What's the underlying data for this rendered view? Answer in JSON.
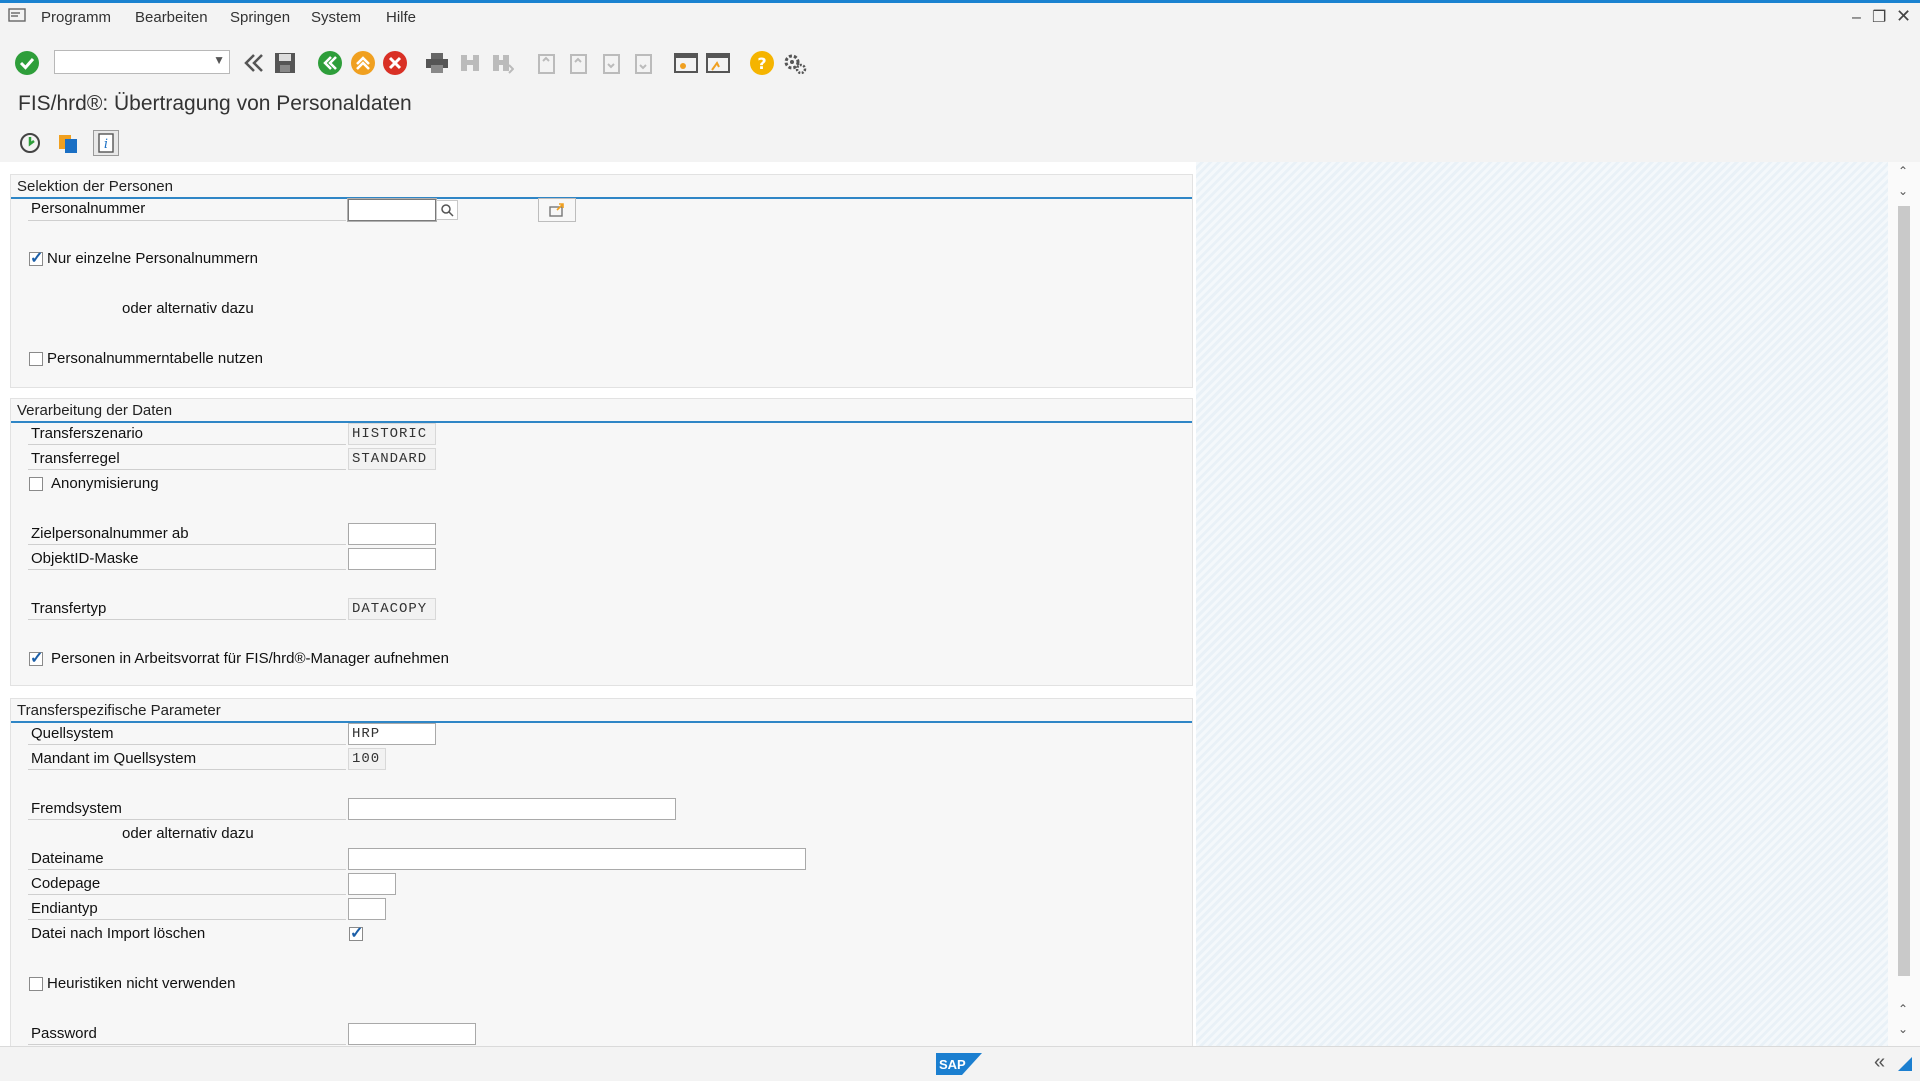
{
  "menu": {
    "items": [
      "Programm",
      "Bearbeiten",
      "Springen",
      "System",
      "Hilfe"
    ]
  },
  "window": {
    "title": "FIS/hrd®: Übertragung von Personaldaten"
  },
  "icons": {
    "enter": "check-icon",
    "command_field": "command-field-dropdown",
    "save": "save-icon",
    "back": "back-icon",
    "exit": "exit-icon",
    "cancel": "cancel-icon",
    "print": "print-icon",
    "find": "find-icon",
    "help": "help-icon",
    "settings": "gear-icon",
    "execute": "execute-icon",
    "variants": "variants-icon",
    "info": "info-icon",
    "search_help": "search-icon",
    "multiple_selection": "multiple-selection-icon",
    "sap_logo": "sap-logo"
  },
  "colors": {
    "accent_line": "#2f86c6",
    "enter_green": "#2e9e3a",
    "exit_orange": "#f0a020",
    "cancel_red": "#d93025",
    "help_yellow": "#f5b400"
  },
  "groups": {
    "selection": {
      "title": "Selektion der Personen",
      "personalnummer_label": "Personalnummer",
      "personalnummer_value": "",
      "only_single_label": "Nur einzelne Personalnummern",
      "only_single_checked": true,
      "or_alternative": "oder alternativ dazu",
      "use_table_label": "Personalnummerntabelle nutzen",
      "use_table_checked": false
    },
    "processing": {
      "title": "Verarbeitung der Daten",
      "scenario_label": "Transferszenario",
      "scenario_value": "HISTORIC",
      "rule_label": "Transferregel",
      "rule_value": "STANDARD",
      "anonymize_label": "Anonymisierung",
      "anonymize_checked": false,
      "target_pernr_label": "Zielpersonalnummer ab",
      "target_pernr_value": "",
      "objectid_label": "ObjektID-Maske",
      "objectid_value": "",
      "type_label": "Transfertyp",
      "type_value": "DATACOPY",
      "worklist_label": "Personen in Arbeitsvorrat für FIS/hrd®-Manager aufnehmen",
      "worklist_checked": true
    },
    "params": {
      "title": "Transferspezifische Parameter",
      "source_label": "Quellsystem",
      "source_value": "HRP",
      "client_label": "Mandant im Quellsystem",
      "client_value": "100",
      "foreign_label": "Fremdsystem",
      "foreign_value": "",
      "or_alternative": "oder alternativ dazu",
      "filename_label": "Dateiname",
      "filename_value": "",
      "codepage_label": "Codepage",
      "codepage_value": "",
      "endian_label": "Endiantyp",
      "endian_value": "",
      "delete_label": "Datei nach Import löschen",
      "delete_checked": true,
      "heuristics_label": "Heuristiken nicht verwenden",
      "heuristics_checked": false,
      "password_label": "Password",
      "password_value": ""
    }
  },
  "status": {
    "logo_text": "SAP"
  }
}
